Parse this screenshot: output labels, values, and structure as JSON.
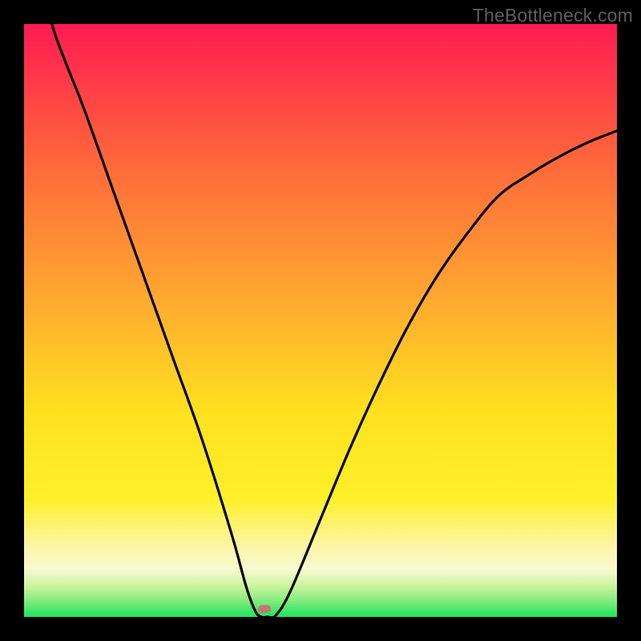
{
  "watermark": {
    "text": "TheBottleneck.com"
  },
  "chart_data": {
    "type": "line",
    "title": "",
    "xlabel": "",
    "ylabel": "",
    "xlim": [
      0,
      100
    ],
    "ylim": [
      0,
      100
    ],
    "gradient_bands": [
      {
        "name": "red-top",
        "color": "#ff1b52"
      },
      {
        "name": "orange",
        "color": "#ffa531"
      },
      {
        "name": "yellow",
        "color": "#ffe81e"
      },
      {
        "name": "pale",
        "color": "#fcf7b9"
      },
      {
        "name": "green-bot",
        "color": "#1ae55c"
      }
    ],
    "series": [
      {
        "name": "bottleneck-curve",
        "x": [
          0,
          2.5,
          5,
          10,
          15,
          20,
          25,
          30,
          35,
          37.5,
          39,
          40,
          41,
          42.5,
          45,
          50,
          55,
          60,
          65,
          70,
          75,
          80,
          85,
          90,
          95,
          100
        ],
        "y": [
          120,
          110,
          99,
          86,
          72,
          58,
          44,
          30,
          14,
          5,
          1,
          0,
          0,
          0.3,
          4.5,
          16.5,
          28.5,
          39.5,
          49.5,
          58,
          65,
          71,
          74.5,
          77.5,
          80,
          82
        ]
      }
    ],
    "marker": {
      "x": 40.5,
      "y": 1.4,
      "color": "#cb7471"
    }
  }
}
